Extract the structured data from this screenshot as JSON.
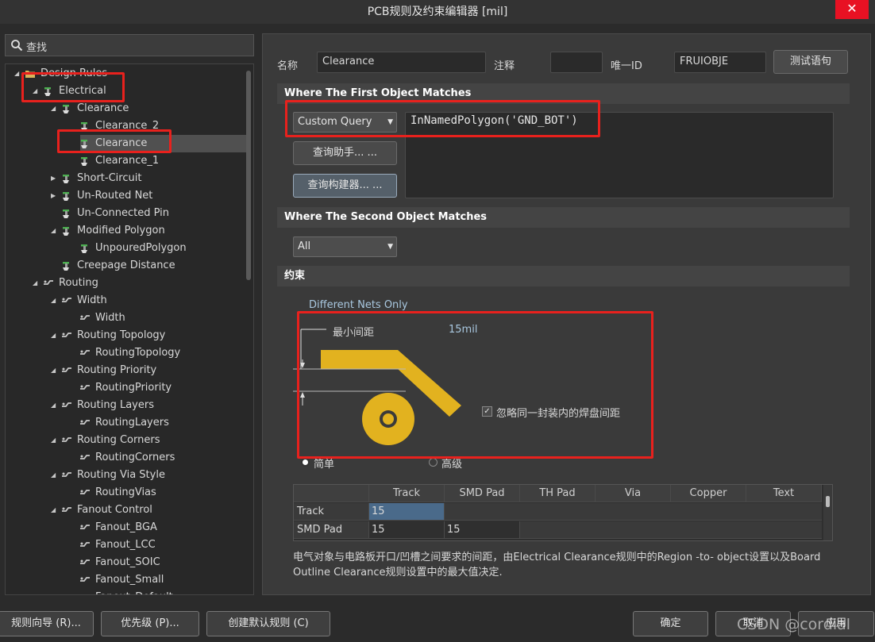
{
  "window": {
    "title": "PCB规则及约束编辑器 [mil]",
    "close_glyph": "✕"
  },
  "search": {
    "label": "查找"
  },
  "tree": {
    "items": [
      {
        "label": "Design Rules",
        "arrow": "◢"
      },
      {
        "label": "Electrical",
        "arrow": "◢"
      },
      {
        "label": "Clearance",
        "arrow": "◢"
      },
      {
        "label": "Clearance_2",
        "arrow": ""
      },
      {
        "label": "Clearance",
        "arrow": ""
      },
      {
        "label": "Clearance_1",
        "arrow": ""
      },
      {
        "label": "Short-Circuit",
        "arrow": "▶"
      },
      {
        "label": "Un-Routed Net",
        "arrow": "▶"
      },
      {
        "label": "Un-Connected Pin",
        "arrow": ""
      },
      {
        "label": "Modified Polygon",
        "arrow": "◢"
      },
      {
        "label": "UnpouredPolygon",
        "arrow": ""
      },
      {
        "label": "Creepage Distance",
        "arrow": ""
      },
      {
        "label": "Routing",
        "arrow": "◢"
      },
      {
        "label": "Width",
        "arrow": "◢"
      },
      {
        "label": "Width",
        "arrow": ""
      },
      {
        "label": "Routing Topology",
        "arrow": "◢"
      },
      {
        "label": "RoutingTopology",
        "arrow": ""
      },
      {
        "label": "Routing Priority",
        "arrow": "◢"
      },
      {
        "label": "RoutingPriority",
        "arrow": ""
      },
      {
        "label": "Routing Layers",
        "arrow": "◢"
      },
      {
        "label": "RoutingLayers",
        "arrow": ""
      },
      {
        "label": "Routing Corners",
        "arrow": "◢"
      },
      {
        "label": "RoutingCorners",
        "arrow": ""
      },
      {
        "label": "Routing Via Style",
        "arrow": "◢"
      },
      {
        "label": "RoutingVias",
        "arrow": ""
      },
      {
        "label": "Fanout Control",
        "arrow": "◢"
      },
      {
        "label": "Fanout_BGA",
        "arrow": ""
      },
      {
        "label": "Fanout_LCC",
        "arrow": ""
      },
      {
        "label": "Fanout_SOIC",
        "arrow": ""
      },
      {
        "label": "Fanout_Small",
        "arrow": ""
      },
      {
        "label": "Fanout_Default",
        "arrow": ""
      }
    ]
  },
  "rule": {
    "name_label": "名称",
    "name_value": "Clearance",
    "comment_label": "注释",
    "comment_value": "",
    "id_label": "唯一ID",
    "id_value": "FRUIOBJE",
    "test_button": "测试语句"
  },
  "first_object": {
    "header": "Where The First Object Matches",
    "query_type": "Custom Query",
    "query_text": "InNamedPolygon('GND_BOT')",
    "helper_button": "查询助手... ...",
    "builder_button": "查询构建器... ..."
  },
  "second_object": {
    "header": "Where The Second Object Matches",
    "selection": "All"
  },
  "constraints": {
    "header": "约束",
    "net_scope": "Different Nets Only",
    "min_clearance_label": "最小间距",
    "min_clearance_value": "15mil",
    "ignore_pad_label": "忽略同一封装内的焊盘间距",
    "ignore_pad_checked": true,
    "mode_simple": "简单",
    "mode_advanced": "高级",
    "copper_color": "#e2b21f"
  },
  "grid": {
    "columns": [
      "",
      "Track",
      "SMD Pad",
      "TH Pad",
      "Via",
      "Copper",
      "Text"
    ],
    "rows": [
      {
        "label": "Track",
        "values": [
          "15",
          "",
          "",
          "",
          "",
          ""
        ]
      },
      {
        "label": "SMD Pad",
        "values": [
          "15",
          "15",
          "",
          "",
          "",
          ""
        ]
      }
    ]
  },
  "description": "电气对象与电路板开口/凹槽之间要求的间距，由Electrical Clearance规则中的Region -to- object设置以及Board Outline Clearance规则设置中的最大值决定.",
  "footer": {
    "wizard": "规则向导 (R)...",
    "priority": "优先级 (P)...",
    "create_default": "创建默认规则 (C)",
    "ok": "确定",
    "cancel": "取消",
    "apply": "应用",
    "watermark": "CSDN @cordial"
  }
}
